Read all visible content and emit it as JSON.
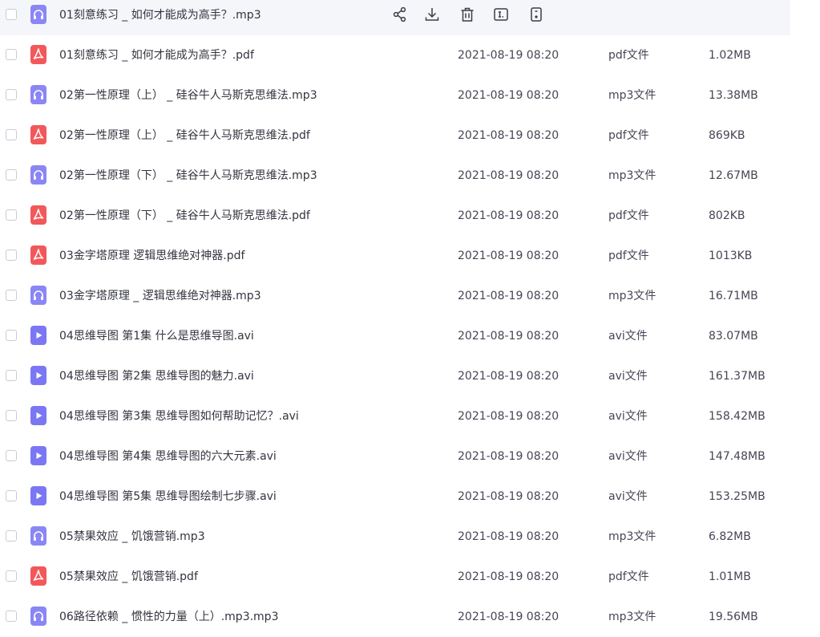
{
  "colors": {
    "audio_icon": "#8b86f5",
    "pdf_icon": "#f2585a",
    "video_icon": "#7b77f4",
    "hover_row": "#f5f6fa",
    "text": "#33343f"
  },
  "row_actions": [
    {
      "icon": "share-icon"
    },
    {
      "icon": "download-icon"
    },
    {
      "icon": "delete-icon"
    },
    {
      "icon": "rename-icon"
    },
    {
      "icon": "more-icon"
    }
  ],
  "files": [
    {
      "icon": "audio-file-icon",
      "name": "01刻意练习 _ 如何才能成为高手？.mp3",
      "date": "",
      "type": "",
      "size": "",
      "hovered": true
    },
    {
      "icon": "pdf-file-icon",
      "name": "01刻意练习 _ 如何才能成为高手？.pdf",
      "date": "2021-08-19 08:20",
      "type": "pdf文件",
      "size": "1.02MB"
    },
    {
      "icon": "audio-file-icon",
      "name": "02第一性原理（上） _ 硅谷牛人马斯克思维法.mp3",
      "date": "2021-08-19 08:20",
      "type": "mp3文件",
      "size": "13.38MB"
    },
    {
      "icon": "pdf-file-icon",
      "name": "02第一性原理（上） _ 硅谷牛人马斯克思维法.pdf",
      "date": "2021-08-19 08:20",
      "type": "pdf文件",
      "size": "869KB"
    },
    {
      "icon": "audio-file-icon",
      "name": "02第一性原理（下） _ 硅谷牛人马斯克思维法.mp3",
      "date": "2021-08-19 08:20",
      "type": "mp3文件",
      "size": "12.67MB"
    },
    {
      "icon": "pdf-file-icon",
      "name": "02第一性原理（下） _ 硅谷牛人马斯克思维法.pdf",
      "date": "2021-08-19 08:20",
      "type": "pdf文件",
      "size": "802KB"
    },
    {
      "icon": "pdf-file-icon",
      "name": "03金字塔原理  逻辑思维绝对神器.pdf",
      "date": "2021-08-19 08:20",
      "type": "pdf文件",
      "size": "1013KB"
    },
    {
      "icon": "audio-file-icon",
      "name": "03金字塔原理 _ 逻辑思维绝对神器.mp3",
      "date": "2021-08-19 08:20",
      "type": "mp3文件",
      "size": "16.71MB"
    },
    {
      "icon": "video-file-icon",
      "name": "04思维导图  第1集 什么是思维导图.avi",
      "date": "2021-08-19 08:20",
      "type": "avi文件",
      "size": "83.07MB"
    },
    {
      "icon": "video-file-icon",
      "name": "04思维导图  第2集 思维导图的魅力.avi",
      "date": "2021-08-19 08:20",
      "type": "avi文件",
      "size": "161.37MB"
    },
    {
      "icon": "video-file-icon",
      "name": "04思维导图  第3集 思维导图如何帮助记忆？.avi",
      "date": "2021-08-19 08:20",
      "type": "avi文件",
      "size": "158.42MB"
    },
    {
      "icon": "video-file-icon",
      "name": "04思维导图  第4集 思维导图的六大元素.avi",
      "date": "2021-08-19 08:20",
      "type": "avi文件",
      "size": "147.48MB"
    },
    {
      "icon": "video-file-icon",
      "name": "04思维导图  第5集 思维导图绘制七步骤.avi",
      "date": "2021-08-19 08:20",
      "type": "avi文件",
      "size": "153.25MB"
    },
    {
      "icon": "audio-file-icon",
      "name": "05禁果效应 _ 饥饿营销.mp3",
      "date": "2021-08-19 08:20",
      "type": "mp3文件",
      "size": "6.82MB"
    },
    {
      "icon": "pdf-file-icon",
      "name": "05禁果效应 _ 饥饿营销.pdf",
      "date": "2021-08-19 08:20",
      "type": "pdf文件",
      "size": "1.01MB"
    },
    {
      "icon": "audio-file-icon",
      "name": "06路径依赖 _ 惯性的力量（上）.mp3.mp3",
      "date": "2021-08-19 08:20",
      "type": "mp3文件",
      "size": "19.56MB"
    }
  ]
}
